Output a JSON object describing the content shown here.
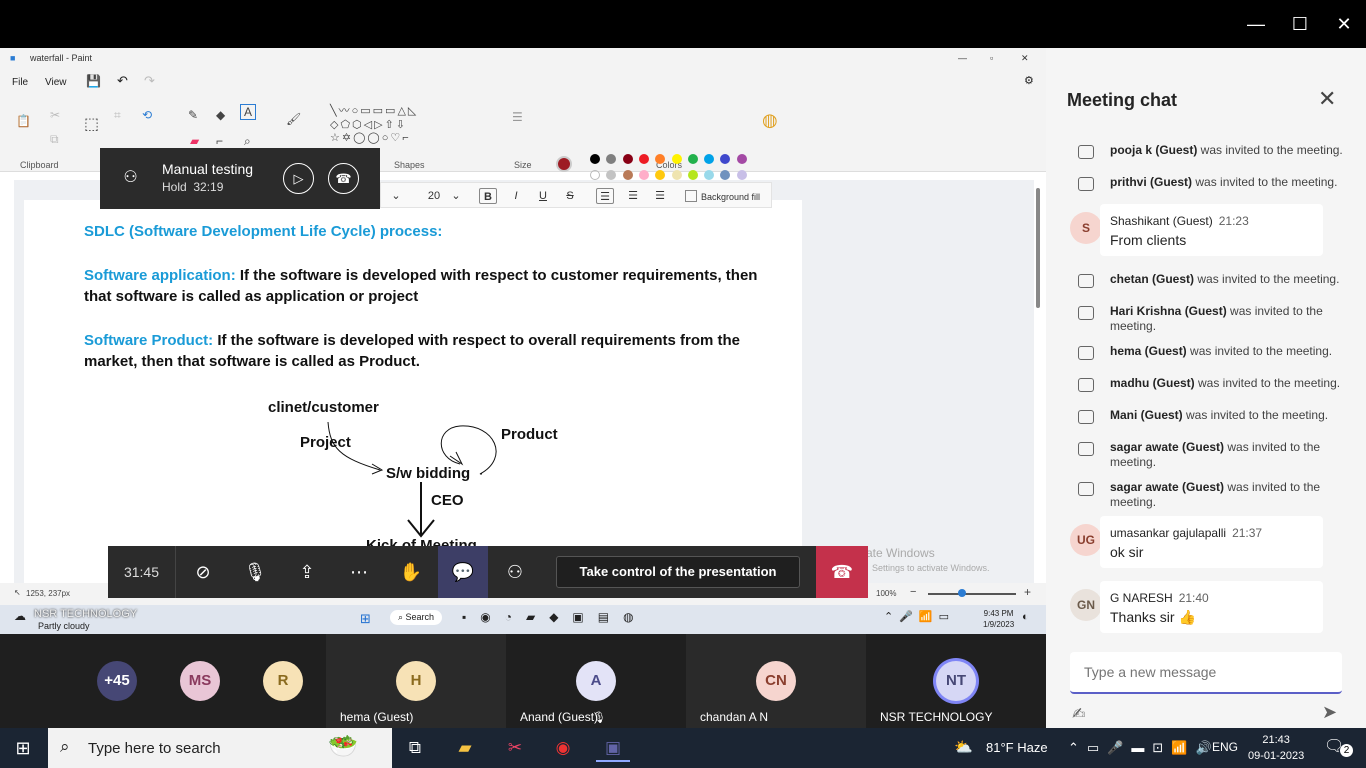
{
  "window": {
    "minimize": "—",
    "maximize": "☐",
    "close": "✕"
  },
  "paint": {
    "title": "waterfall - Paint",
    "win_min": "—",
    "win_restore": "▫",
    "win_close": "✕",
    "menu": {
      "file": "File",
      "view": "View"
    },
    "ribbon": {
      "clipboard": "Clipboard",
      "shapes": "Shapes",
      "size": "Size",
      "colors": "Colors"
    },
    "textbar": {
      "font_size": "20",
      "bold": "B",
      "italic": "I",
      "underline": "U",
      "strike": "S",
      "background_fill": "Background fill"
    },
    "doc": {
      "heading": "SDLC (Software Development Life Cycle) process:",
      "app_term": "Software application:",
      "app_def_line1": " If the software is developed with respect to customer requirements, then",
      "app_def_line2": "that software is called as application or project",
      "prod_term": "Software Product:",
      "prod_def_line1": " If the software is developed with respect to overall requirements from the",
      "prod_def_line2": "market, then that software is called as Product."
    },
    "diagram": {
      "client": "clinet/customer",
      "project": "Project",
      "product": "Product",
      "bidding": "S/w bidding",
      "ceo": "CEO",
      "kickoff": "Kick of Meeting"
    },
    "status": {
      "coords": "1253, 237px",
      "zoom": "100%"
    },
    "watermark": {
      "line1": "vate Windows",
      "line2": "Settings to activate Windows."
    },
    "inner_taskbar": {
      "org": "NSR TECHNOLOGY",
      "weather": "Partly cloudy",
      "search": "Search",
      "time": "9:43 PM",
      "date": "1/9/2023"
    }
  },
  "hold_banner": {
    "title": "Manual testing",
    "status": "Hold",
    "time": "32:19"
  },
  "call_controls": {
    "timer": "31:45",
    "take_control": "Take control of the presentation"
  },
  "participants": [
    {
      "initials": "+45",
      "name": "",
      "color": "#464775",
      "fg": "#ffffff"
    },
    {
      "initials": "MS",
      "name": "",
      "color": "#e9c6d6",
      "fg": "#8a3a5e"
    },
    {
      "initials": "R",
      "name": "",
      "color": "#f7e2b6",
      "fg": "#8a6a1e"
    },
    {
      "initials": "H",
      "name": "hema (Guest)",
      "color": "#f7e2b6",
      "fg": "#8a6a1e"
    },
    {
      "initials": "A",
      "name": "Anand (Guest)",
      "color": "#e3e3f7",
      "fg": "#4b4b8a"
    },
    {
      "initials": "CN",
      "name": "chandan A N",
      "color": "#f6d5cf",
      "fg": "#8a3e2e"
    },
    {
      "initials": "NT",
      "name": "NSR TECHNOLOGY",
      "color": "#d6d7f5",
      "fg": "#464775"
    }
  ],
  "chat": {
    "title": "Meeting chat",
    "system": [
      {
        "who": "pooja k (Guest)",
        "text": " was invited to the meeting."
      },
      {
        "who": "prithvi (Guest)",
        "text": " was invited to the meeting."
      },
      {
        "who": "chetan (Guest)",
        "text": " was invited to the meeting."
      },
      {
        "who": "Hari Krishna (Guest)",
        "text": " was invited to the meeting."
      },
      {
        "who": "hema (Guest)",
        "text": " was invited to the meeting."
      },
      {
        "who": "madhu (Guest)",
        "text": " was invited to the meeting."
      },
      {
        "who": "Mani (Guest)",
        "text": " was invited to the meeting."
      },
      {
        "who": "sagar awate (Guest)",
        "text": " was invited to the meeting."
      },
      {
        "who": "sagar awate (Guest)",
        "text": " was invited to the meeting."
      }
    ],
    "messages": [
      {
        "initials": "S",
        "name": "Shashikant (Guest)",
        "time": "21:23",
        "text": "From clients"
      },
      {
        "initials": "UG",
        "name": "umasankar gajulapalli",
        "time": "21:37",
        "text": "ok sir"
      },
      {
        "initials": "GN",
        "name": "G NARESH",
        "time": "21:40",
        "text": "Thanks sir 👍"
      }
    ],
    "placeholder": "Type a new message"
  },
  "taskbar": {
    "search_placeholder": "Type here to search",
    "weather": "81°F  Haze",
    "lang": "ENG",
    "time": "21:43",
    "date": "09-01-2023",
    "notifications": "2"
  }
}
